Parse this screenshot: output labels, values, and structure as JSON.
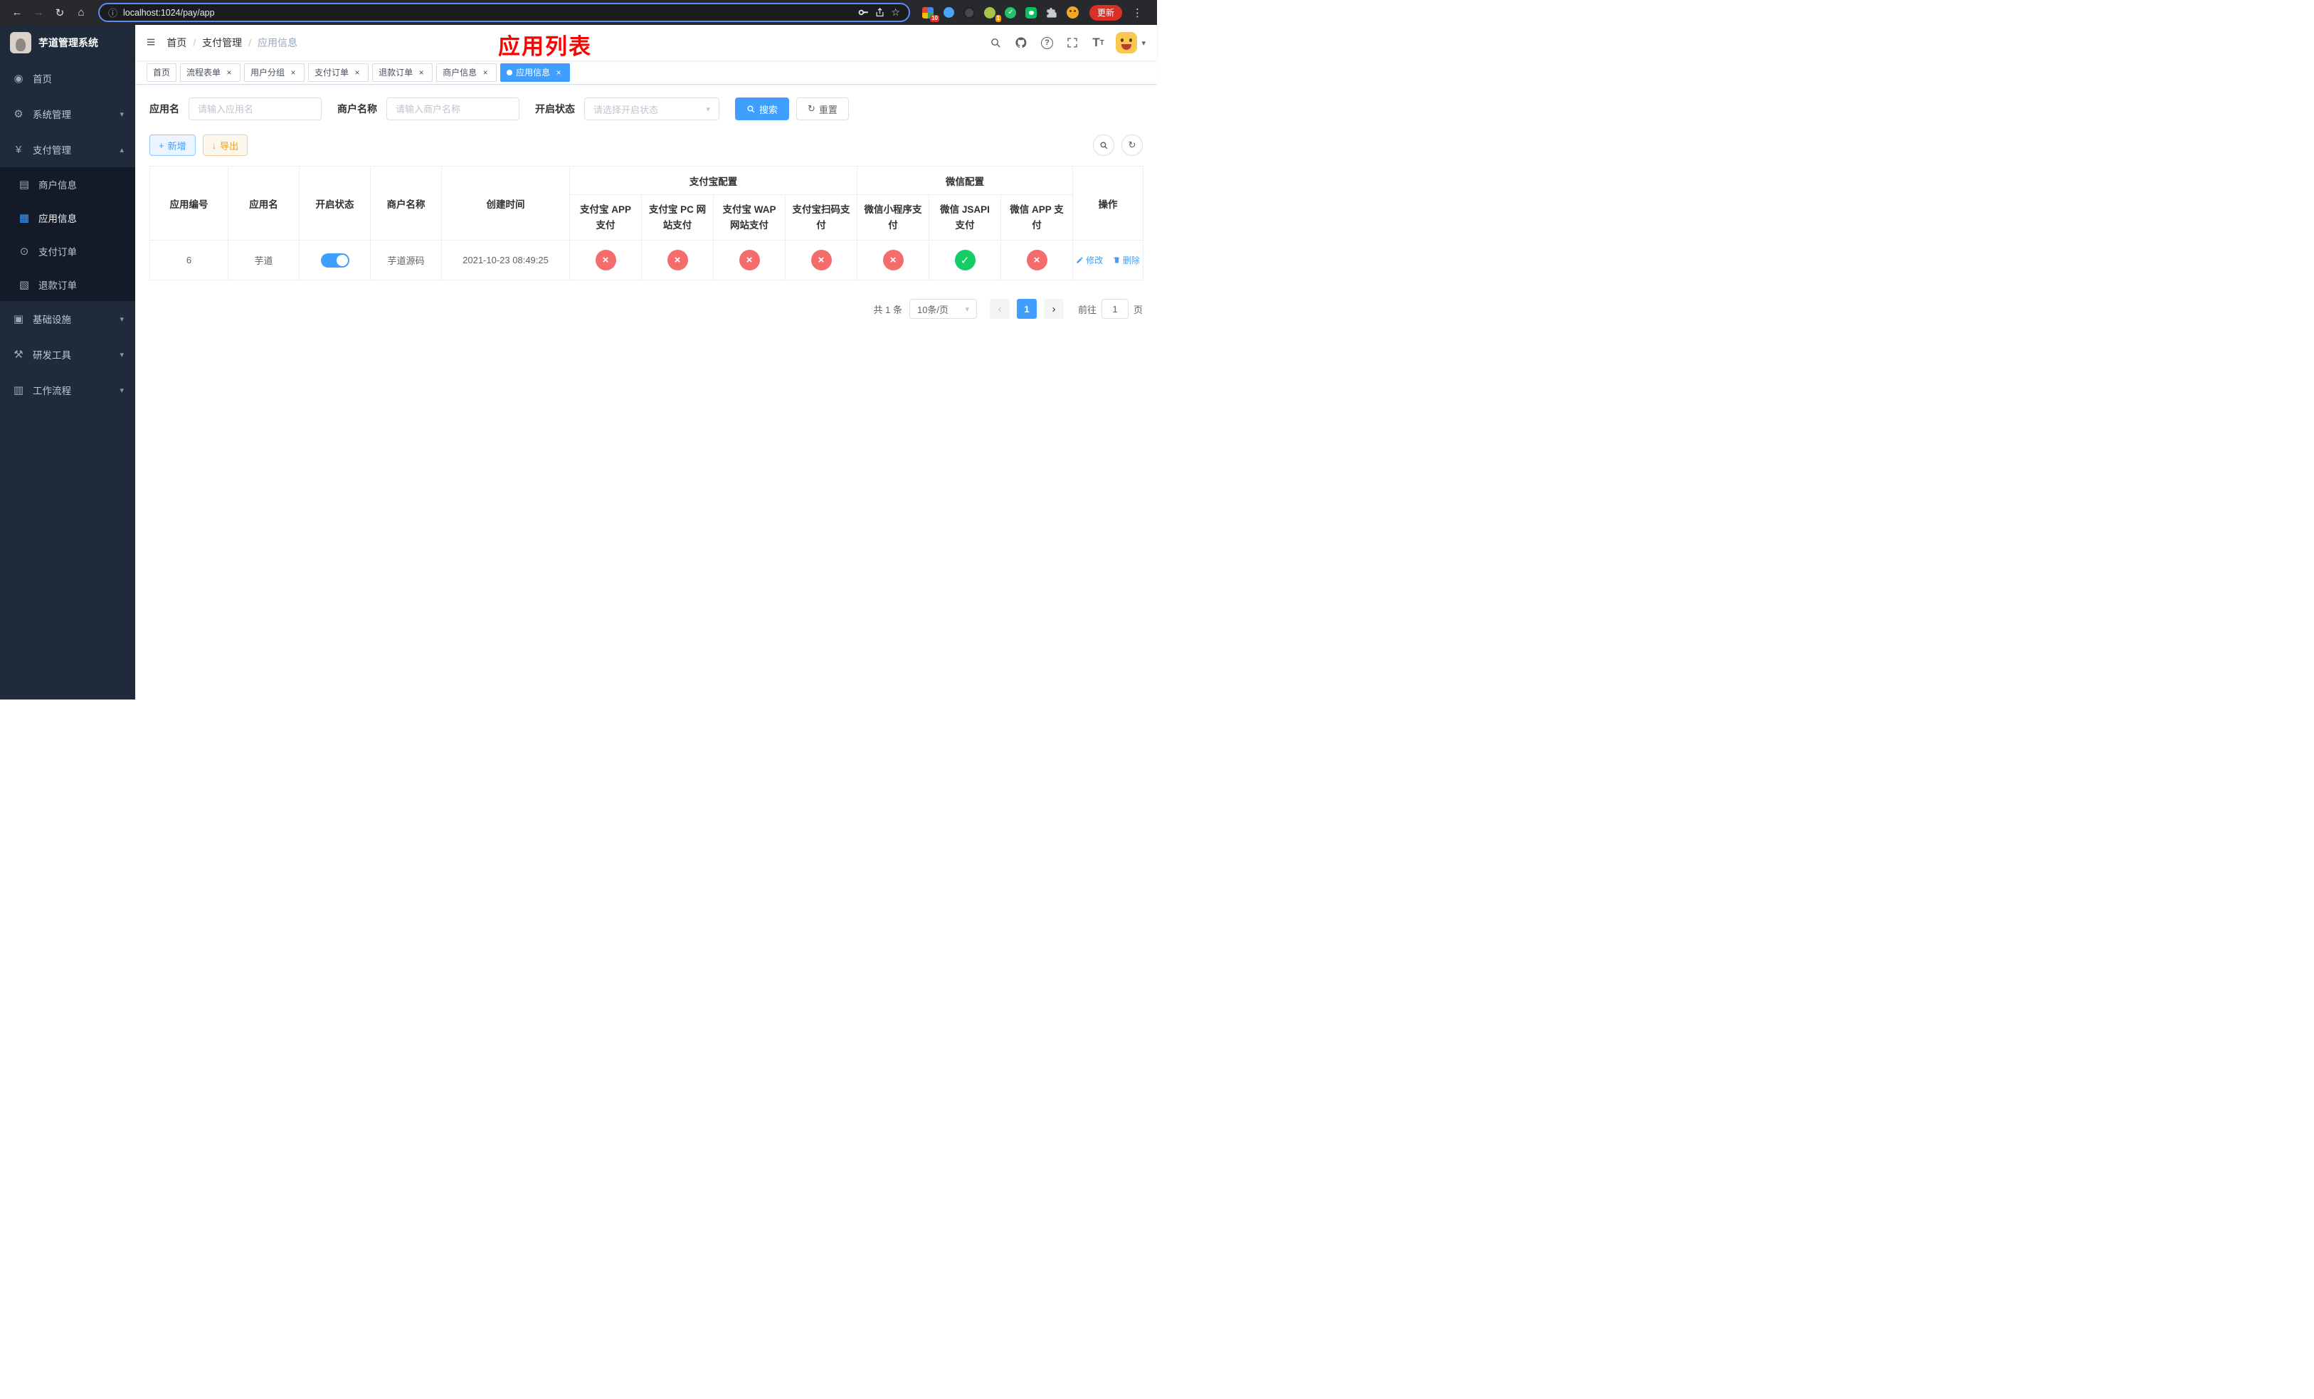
{
  "browser": {
    "url": "localhost:1024/pay/app",
    "update_label": "更新",
    "extension_badge_10": "10",
    "extension_badge_1": "1"
  },
  "icons": {
    "back": "←",
    "forward": "→",
    "reload": "↻",
    "home": "⌂",
    "info": "ⓘ",
    "star": "☆",
    "menu_dots": "⋮",
    "hamburger": "≡",
    "slash": "/",
    "caret_down": "▾",
    "chevron_down": "▾",
    "chevron_up": "▴",
    "plus": "+",
    "download": "↓",
    "refresh": "↻",
    "help": "?",
    "font_size_big": "T",
    "font_size_small": "T",
    "close": "×",
    "prev": "‹",
    "next": "›",
    "dashboard": "◉",
    "gear": "⚙",
    "yen": "¥",
    "merchant": "▤",
    "app": "▦",
    "order": "⊙",
    "refund": "▧",
    "infra": "▣",
    "tools": "⚒",
    "workflow": "▥",
    "wechat_check": "✓"
  },
  "colors": {
    "primary": "#409eff",
    "danger": "#f56c6c",
    "success": "#13ce66",
    "warning": "#e6a23c",
    "overlay_title": "#ff0000",
    "update_button": "#d93025",
    "sidebar_bg": "#1f2b3a"
  },
  "sidebar": {
    "title": "芋道管理系统",
    "items": [
      {
        "label": "首页"
      },
      {
        "label": "系统管理"
      },
      {
        "label": "支付管理"
      },
      {
        "label": "基础设施"
      },
      {
        "label": "研发工具"
      },
      {
        "label": "工作流程"
      }
    ],
    "submenu": [
      {
        "label": "商户信息"
      },
      {
        "label": "应用信息"
      },
      {
        "label": "支付订单"
      },
      {
        "label": "退款订单"
      }
    ]
  },
  "header": {
    "breadcrumb": [
      "首页",
      "支付管理",
      "应用信息"
    ],
    "overlay_title": "应用列表"
  },
  "tabs": [
    {
      "label": "首页"
    },
    {
      "label": "流程表单"
    },
    {
      "label": "用户分组"
    },
    {
      "label": "支付订单"
    },
    {
      "label": "退款订单"
    },
    {
      "label": "商户信息"
    },
    {
      "label": "应用信息"
    }
  ],
  "filters": {
    "app_name_label": "应用名",
    "app_name_placeholder": "请输入应用名",
    "merchant_label": "商户名称",
    "merchant_placeholder": "请输入商户名称",
    "status_label": "开启状态",
    "status_placeholder": "请选择开启状态",
    "search_label": "搜索",
    "reset_label": "重置"
  },
  "toolbar": {
    "add_label": "新增",
    "export_label": "导出"
  },
  "table": {
    "group_alipay": "支付宝配置",
    "group_wechat": "微信配置",
    "columns": [
      "应用编号",
      "应用名",
      "开启状态",
      "商户名称",
      "创建时间",
      "操作"
    ],
    "sub_columns": [
      "支付宝 APP 支付",
      "支付宝 PC 网站支付",
      "支付宝 WAP 网站支付",
      "支付宝扫码支付",
      "微信小程序支付",
      "微信 JSAPI 支付",
      "微信 APP 支付"
    ],
    "rows": [
      {
        "id": "6",
        "name": "芋道",
        "enabled": true,
        "merchant": "芋道源码",
        "created": "2021-10-23 08:49:25",
        "configs": [
          "no",
          "no",
          "no",
          "no",
          "no",
          "yes",
          "no"
        ],
        "edit_label": "修改",
        "delete_label": "删除"
      }
    ]
  },
  "pagination": {
    "total": "共 1 条",
    "page_size": "10条/页",
    "current_page": "1",
    "goto_prefix": "前往",
    "goto_suffix": "页",
    "goto_value": "1"
  }
}
